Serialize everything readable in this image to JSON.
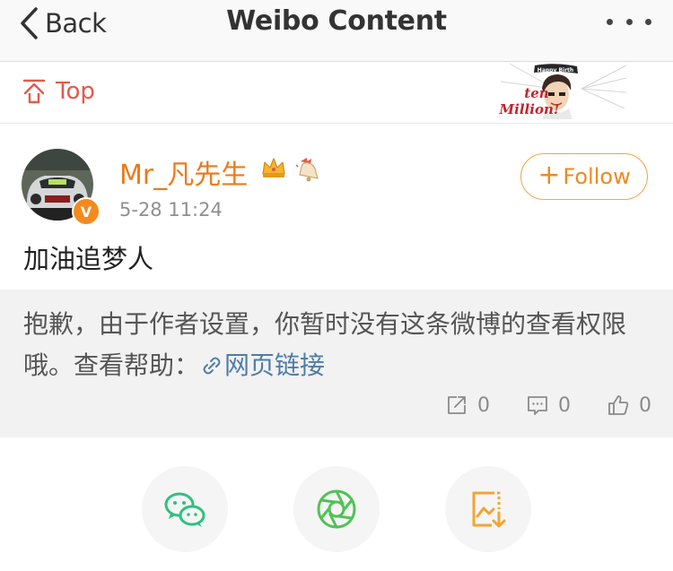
{
  "navbar": {
    "back_label": "Back",
    "title": "Weibo Content"
  },
  "topbar": {
    "top_label": "Top",
    "sticker_text": [
      "Happy Birth",
      "ten",
      "Million"
    ]
  },
  "post": {
    "username": "Mr_凡先生",
    "timestamp": "5-28 11:24",
    "verified_badge": "V",
    "follow_label": "Follow",
    "follow_plus": "+",
    "text": "加油追梦人"
  },
  "retweet": {
    "notice": "抱歉，由于作者设置，你暂时没有这条微博的查看权限哦。查看帮助：",
    "link_label": "网页链接",
    "reposts": "0",
    "comments": "0",
    "likes": "0"
  },
  "share": {
    "items": [
      "wechat-icon",
      "moments-icon",
      "save-image-icon"
    ]
  },
  "colors": {
    "accent": "#ee8a22",
    "top_red": "#e4584b",
    "link": "#4f7ca6",
    "wechat": "#2ec17f",
    "moments": "#50c255",
    "save": "#f2a532"
  }
}
